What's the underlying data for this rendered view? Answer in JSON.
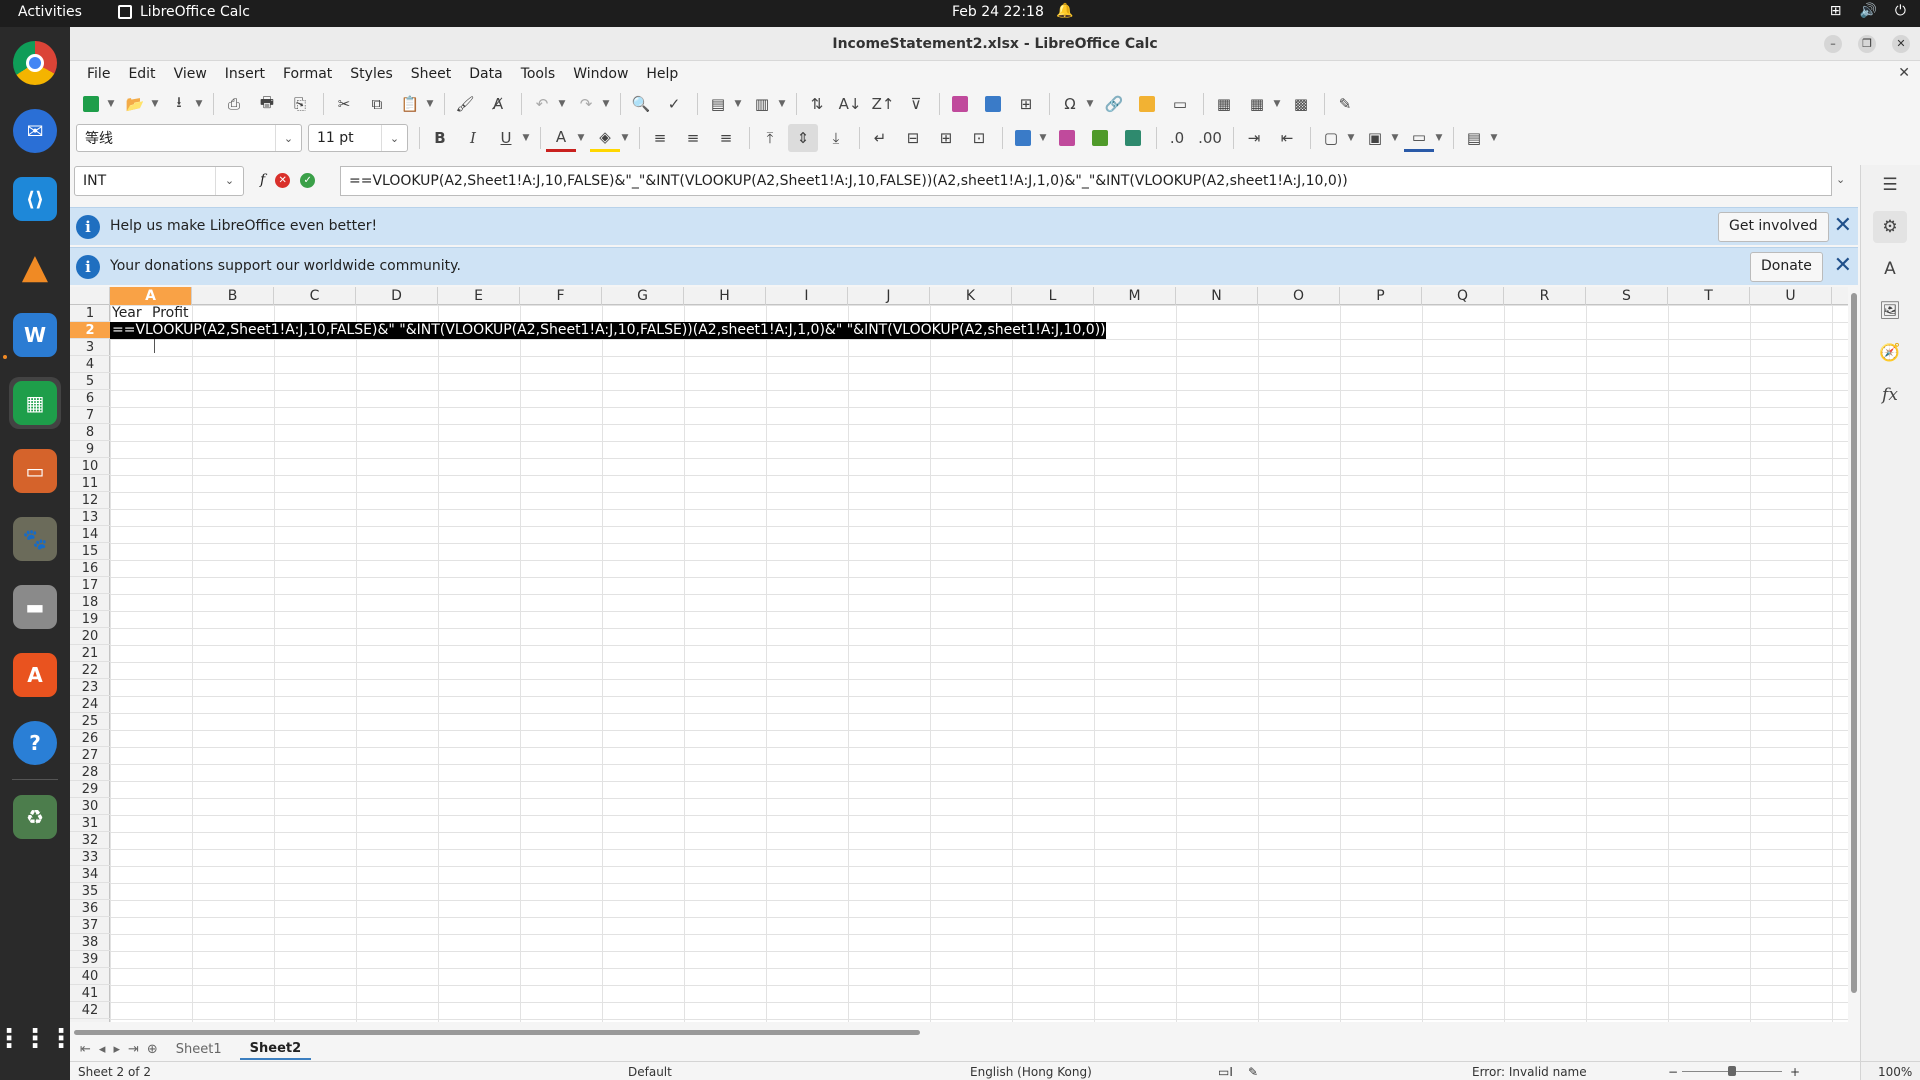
{
  "topbar": {
    "activities": "Activities",
    "app_name": "LibreOffice Calc",
    "clock": "Feb 24  22:18"
  },
  "window": {
    "title": "IncomeStatement2.xlsx - LibreOffice Calc"
  },
  "menubar": {
    "items": [
      "File",
      "Edit",
      "View",
      "Insert",
      "Format",
      "Styles",
      "Sheet",
      "Data",
      "Tools",
      "Window",
      "Help"
    ]
  },
  "toolbar2": {
    "font_name": "等线",
    "font_size": "11 pt"
  },
  "formula_bar": {
    "name_box": "INT",
    "fx_label": "f",
    "formula": "==VLOOKUP(A2,Sheet1!A:J,10,FALSE)&\"_\"&INT(VLOOKUP(A2,Sheet1!A:J,10,FALSE))(A2,sheet1!A:J,1,0)&\"_\"&INT(VLOOKUP(A2,sheet1!A:J,10,0))"
  },
  "infobars": [
    {
      "text": "Help us make LibreOffice even better!",
      "button": "Get involved"
    },
    {
      "text": "Your donations support our worldwide community.",
      "button": "Donate"
    }
  ],
  "grid": {
    "columns": [
      "A",
      "B",
      "C",
      "D",
      "E",
      "F",
      "G",
      "H",
      "I",
      "J",
      "K",
      "L",
      "M",
      "N",
      "O",
      "P",
      "Q",
      "R",
      "S",
      "T",
      "U"
    ],
    "selected_column": "A",
    "rows": [
      "1",
      "2",
      "3",
      "4",
      "5",
      "6",
      "7",
      "8",
      "9",
      "10",
      "11",
      "12",
      "13",
      "14",
      "15",
      "16",
      "17",
      "18",
      "19",
      "20",
      "21",
      "22",
      "23",
      "24",
      "25",
      "26",
      "27",
      "28",
      "29",
      "30",
      "31",
      "32",
      "33",
      "34",
      "35",
      "36",
      "37",
      "38",
      "39",
      "40",
      "41",
      "42"
    ],
    "selected_row": "2",
    "cell_a1": "Year",
    "cell_b1": "Profit",
    "cell_a2": "==VLOOKUP(A2,Sheet1!A:J,10,FALSE)&\"  \"&INT(VLOOKUP(A2,Sheet1!A:J,10,FALSE))(A2,sheet1!A:J,1,0)&\"  \"&INT(VLOOKUP(A2,sheet1!A:J,10,0))"
  },
  "sheets": {
    "tabs": [
      "Sheet1",
      "Sheet2"
    ],
    "active": "Sheet2"
  },
  "statusbar": {
    "sheet_info": "Sheet 2 of 2",
    "page_style": "Default",
    "language": "English (Hong Kong)",
    "error": "Error: Invalid name",
    "zoom": "100%"
  }
}
